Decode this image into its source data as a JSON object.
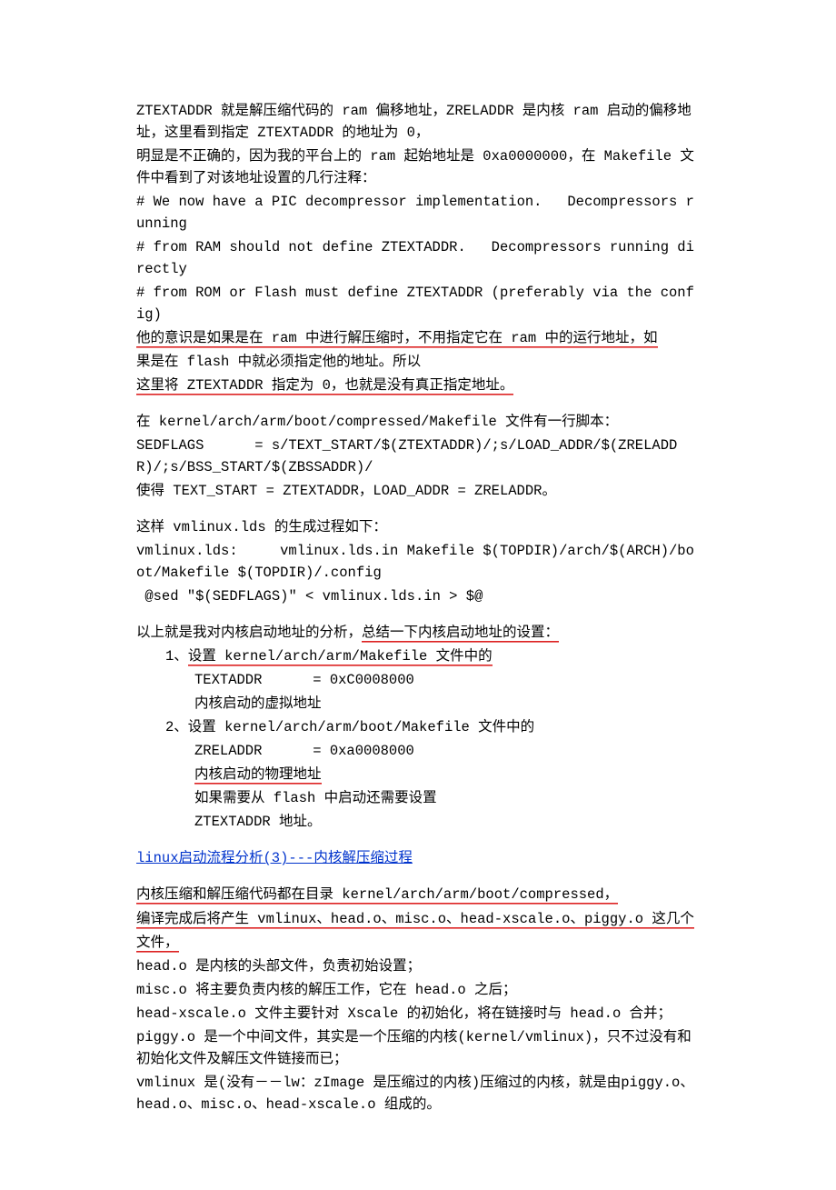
{
  "p1": "ZTEXTADDR 就是解压缩代码的 ram 偏移地址，ZRELADDR 是内核 ram 启动的偏移地址，这里看到指定 ZTEXTADDR 的地址为 0，",
  "p2": "明显是不正确的，因为我的平台上的 ram 起始地址是 0xa0000000，在 Makefile 文件中看到了对该地址设置的几行注释：",
  "p3": "# We now have a PIC decompressor implementation.   Decompressors running",
  "p4": "# from RAM should not define ZTEXTADDR.   Decompressors running directly",
  "p5": "# from ROM or Flash must define ZTEXTADDR (preferably via the config)",
  "p6a": "他的意识是如果是在 ram 中进行解压缩时，不用指定它在 ram 中的运行地址，如",
  "p6b": "果是在 flash 中就必须指定他的地址。所以",
  "p7": "这里将 ZTEXTADDR 指定为 0，也就是没有真正指定地址。",
  "p8": "在 kernel/arch/arm/boot/compressed/Makefile 文件有一行脚本：",
  "p9": "SEDFLAGS      = s/TEXT_START/$(ZTEXTADDR)/;s/LOAD_ADDR/$(ZRELADDR)/;s/BSS_START/$(ZBSSADDR)/",
  "p10": "使得 TEXT_START = ZTEXTADDR，LOAD_ADDR = ZRELADDR。",
  "p11": "这样 vmlinux.lds 的生成过程如下：",
  "p12": "vmlinux.lds:     vmlinux.lds.in Makefile $(TOPDIR)/arch/$(ARCH)/boot/Makefile $(TOPDIR)/.config",
  "p13": " @sed \"$(SEDFLAGS)\" < vmlinux.lds.in > $@",
  "p14a": "以上就是我对内核启动地址的分析，",
  "p14b": "总结一下内核启动地址的设置：",
  "li1a_pre": "1、",
  "li1a": "设置 kernel/arch/arm/Makefile 文件中的",
  "li1b": "TEXTADDR      = 0xC0008000",
  "li1c": "内核启动的虚拟地址",
  "li2a": "2、设置 kernel/arch/arm/boot/Makefile 文件中的",
  "li2b": "ZRELADDR      = 0xa0008000",
  "li2c": "内核启动的物理地址",
  "li2d": "如果需要从 flash 中启动还需要设置",
  "li2e": "ZTEXTADDR 地址。",
  "link1": "linux启动流程分析(3)---内核解压缩过程",
  "p15": "内核压缩和解压缩代码都在目录 kernel/arch/arm/boot/compressed，",
  "p16a": "编译完成后将产生 vmlinux、head.o、misc.o、head-xscale.o、piggy.o 这几个",
  "p16b": "文件，",
  "p17": "head.o 是内核的头部文件，负责初始设置；",
  "p18": "misc.o 将主要负责内核的解压工作，它在 head.o 之后；",
  "p19": "head-xscale.o 文件主要针对 Xscale 的初始化，将在链接时与 head.o 合并；",
  "p20": "piggy.o 是一个中间文件，其实是一个压缩的内核(kernel/vmlinux)，只不过没有和初始化文件及解压文件链接而已；",
  "p21": "vmlinux 是(没有－－lw：zImage 是压缩过的内核)压缩过的内核，就是由piggy.o、head.o、misc.o、head-xscale.o 组成的。"
}
